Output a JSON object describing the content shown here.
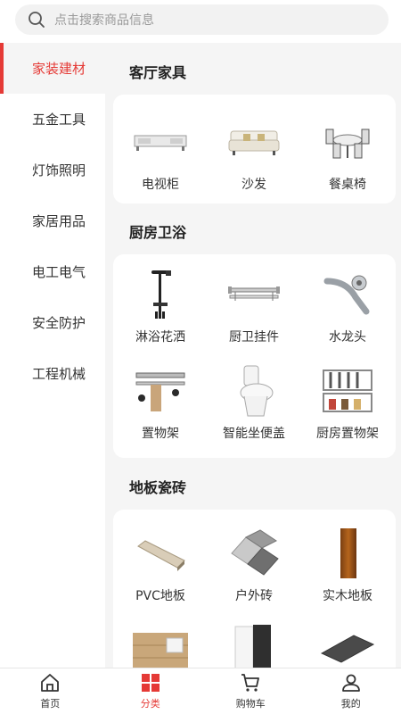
{
  "search": {
    "placeholder": "点击搜索商品信息",
    "icon": "search-icon"
  },
  "sidebar": {
    "items": [
      {
        "label": "家装建材",
        "active": true
      },
      {
        "label": "五金工具"
      },
      {
        "label": "灯饰照明"
      },
      {
        "label": "家居用品"
      },
      {
        "label": "电工电气"
      },
      {
        "label": "安全防护"
      },
      {
        "label": "工程机械"
      }
    ]
  },
  "sections": [
    {
      "title": "客厅家具",
      "items": [
        {
          "label": "电视柜"
        },
        {
          "label": "沙发"
        },
        {
          "label": "餐桌椅"
        }
      ]
    },
    {
      "title": "厨房卫浴",
      "items": [
        {
          "label": "淋浴花洒"
        },
        {
          "label": "厨卫挂件"
        },
        {
          "label": "水龙头"
        },
        {
          "label": "置物架"
        },
        {
          "label": "智能坐便盖"
        },
        {
          "label": "厨房置物架"
        }
      ]
    },
    {
      "title": "地板瓷砖",
      "items": [
        {
          "label": "PVC地板"
        },
        {
          "label": "户外砖"
        },
        {
          "label": "实木地板"
        }
      ]
    }
  ],
  "tabbar": {
    "tabs": [
      {
        "label": "首页",
        "icon": "home-icon"
      },
      {
        "label": "分类",
        "icon": "category-grid-icon",
        "active": true
      },
      {
        "label": "购物车",
        "icon": "cart-icon"
      },
      {
        "label": "我的",
        "icon": "user-icon"
      }
    ]
  },
  "colors": {
    "accent": "#e53a36",
    "background": "#f5f5f5"
  }
}
